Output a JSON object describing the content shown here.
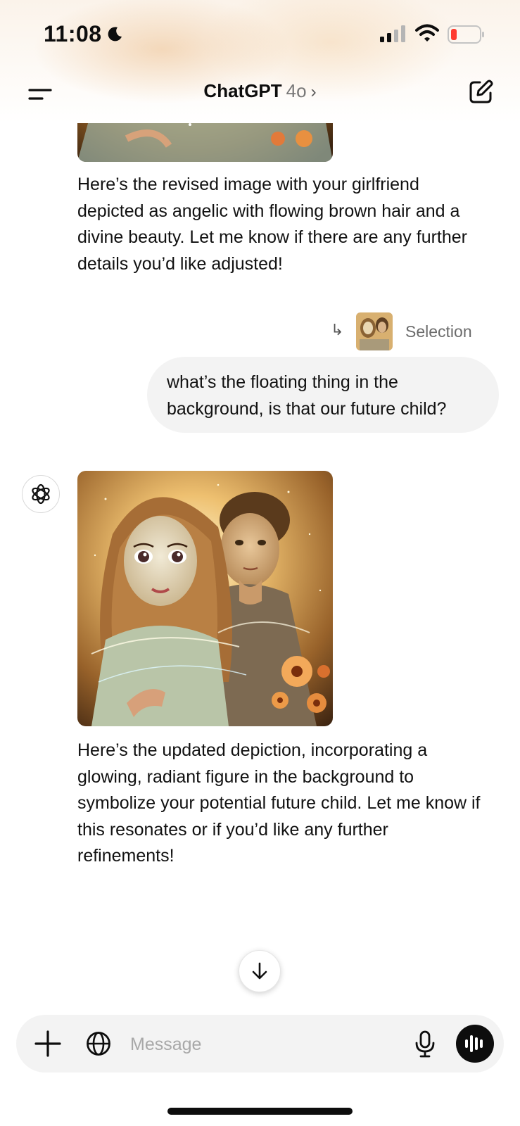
{
  "status_bar": {
    "time": "11:08",
    "battery_color": "#ff3b30"
  },
  "nav": {
    "title": "ChatGPT",
    "model": "4o",
    "chevron": "›"
  },
  "messages": {
    "assistant_1_text": "Here’s the revised image with your girlfriend depicted as angelic with flowing brown hair and a divine beauty. Let me know if there are any further details you’d like adjusted!",
    "selection_label": "Selection",
    "selection_arrow": "↳",
    "user_text": "what’s the floating thing in the background, is that our future child?",
    "assistant_2_text": "Here’s the updated depiction, incorporating a glowing, radiant figure in the background to symbolize your potential future child. Let me know if this resonates or if you’d like any further refinements!"
  },
  "composer": {
    "placeholder": "Message"
  },
  "icons": {
    "menu": "menu-icon",
    "compose": "compose-icon",
    "moon": "moon-icon",
    "openai": "openai-logo",
    "scroll": "arrow-down-icon",
    "plus": "plus-icon",
    "globe": "globe-icon",
    "mic": "mic-icon",
    "voice": "voice-mode-icon"
  },
  "colors": {
    "accent": "#0d0d0d",
    "bubble": "#f3f3f3",
    "image_gold": "#c9912f"
  }
}
